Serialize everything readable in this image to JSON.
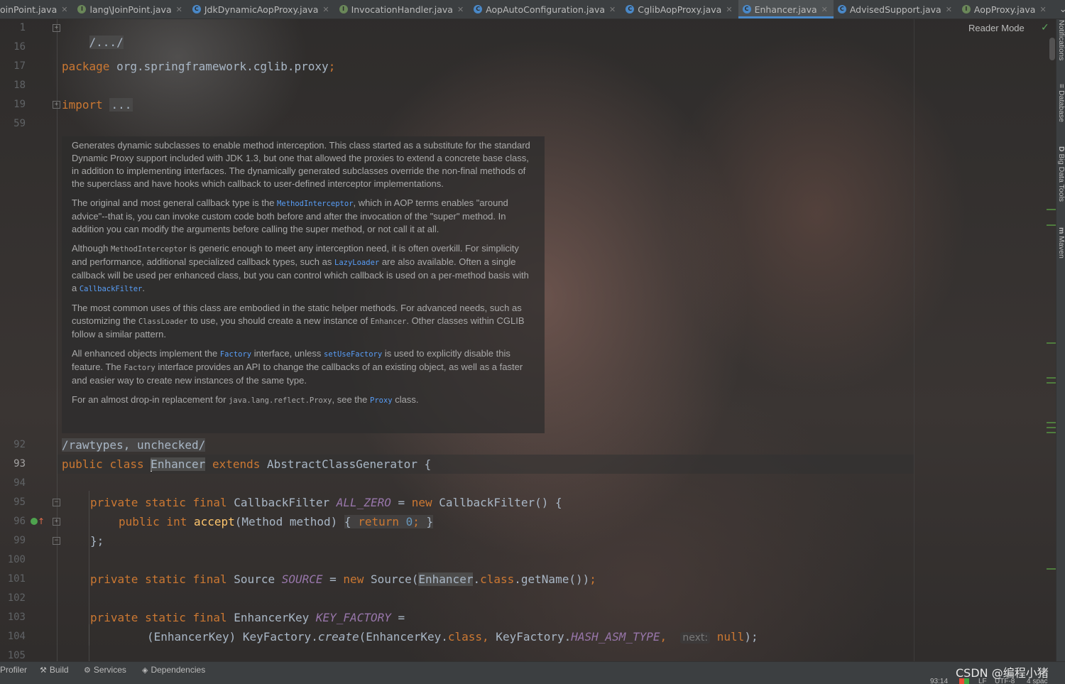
{
  "tabs": [
    {
      "label": "oinPoint.java",
      "icon": "interface-icon",
      "kind": "i"
    },
    {
      "label": "lang\\JoinPoint.java",
      "icon": "interface-icon",
      "kind": "i"
    },
    {
      "label": "JdkDynamicAopProxy.java",
      "icon": "class-icon",
      "kind": "c"
    },
    {
      "label": "InvocationHandler.java",
      "icon": "interface-icon",
      "kind": "i"
    },
    {
      "label": "AopAutoConfiguration.java",
      "icon": "class-icon",
      "kind": "c"
    },
    {
      "label": "CglibAopProxy.java",
      "icon": "class-icon",
      "kind": "c"
    },
    {
      "label": "Enhancer.java",
      "icon": "class-icon",
      "kind": "c",
      "active": true
    },
    {
      "label": "AdvisedSupport.java",
      "icon": "class-icon",
      "kind": "c"
    },
    {
      "label": "AopProxy.java",
      "icon": "interface-icon",
      "kind": "i"
    }
  ],
  "line_numbers": [
    {
      "n": "1"
    },
    {
      "n": "16"
    },
    {
      "n": "17"
    },
    {
      "n": "18"
    },
    {
      "n": "19"
    },
    {
      "n": "59"
    },
    {
      "n": "92"
    },
    {
      "n": "93"
    },
    {
      "n": "94"
    },
    {
      "n": "95"
    },
    {
      "n": "96"
    },
    {
      "n": "99"
    },
    {
      "n": "100"
    },
    {
      "n": "101"
    },
    {
      "n": "102"
    },
    {
      "n": "103"
    },
    {
      "n": "104"
    },
    {
      "n": "105"
    }
  ],
  "code": {
    "l1": "/.../",
    "l17_kw": "package",
    "l17_rest": " org.springframework.cglib.proxy",
    "l17_semi": ";",
    "l19_kw": "import",
    "l19_fold": "...",
    "l92": "/rawtypes, unchecked/",
    "l93_kw1": "public",
    "l93_kw2": "class",
    "l93_name": "Enhancer",
    "l93_kw3": "extends",
    "l93_rest": " AbstractClassGenerator {",
    "l95_kw": "private static final",
    "l95_type": " CallbackFilter ",
    "l95_const": "ALL_ZERO",
    "l95_eq": " = ",
    "l95_new": "new",
    "l95_rest": " CallbackFilter() {",
    "l96_kw": "public int",
    "l96_fn": "accept",
    "l96_args": "(Method method)",
    "l96_ob": "{",
    "l96_ret": "return",
    "l96_num": "0",
    "l96_semi": ";",
    "l96_cb": "}",
    "l99": "};",
    "l101_kw": "private static final",
    "l101_type": " Source ",
    "l101_const": "SOURCE",
    "l101_eq": " = ",
    "l101_new": "new",
    "l101_rest1": " Source(",
    "l101_ref": "Enhancer",
    "l101_dot": ".",
    "l101_class": "class",
    "l101_rest2": ".getName())",
    "l101_semi": ";",
    "l103_kw": "private static final",
    "l103_type": " EnhancerKey ",
    "l103_const": "KEY_FACTORY",
    "l103_eq": " =",
    "l104_a": "(EnhancerKey) KeyFactory.",
    "l104_create": "create",
    "l104_b": "(EnhancerKey.",
    "l104_class": "class",
    "l104_comma": ",",
    "l104_c": " KeyFactory.",
    "l104_const": "HASH_ASM_TYPE",
    "l104_comma2": ",",
    "l104_hint": "next:",
    "l104_null": "null",
    "l104_end": ");"
  },
  "doc": {
    "p1": "Generates dynamic subclasses to enable method interception. This class started as a substitute for the standard Dynamic Proxy support included with JDK 1.3, but one that allowed the proxies to extend a concrete base class, in addition to implementing interfaces. The dynamically generated subclasses override the non-final methods of the superclass and have hooks which callback to user-defined interceptor implementations.",
    "p2a": "The original and most general callback type is the ",
    "p2code": "MethodInterceptor",
    "p2b": ", which in AOP terms enables \"around advice\"--that is, you can invoke custom code both before and after the invocation of the \"super\" method. In addition you can modify the arguments before calling the super method, or not call it at all.",
    "p3a": "Although ",
    "p3code1": "MethodInterceptor",
    "p3b": " is generic enough to meet any interception need, it is often overkill. For simplicity and performance, additional specialized callback types, such as ",
    "p3code2": "LazyLoader",
    "p3c": " are also available. Often a single callback will be used per enhanced class, but you can control which callback is used on a per-method basis with a ",
    "p3code3": "CallbackFilter",
    "p3d": ".",
    "p4a": "The most common uses of this class are embodied in the static helper methods. For advanced needs, such as customizing the ",
    "p4code1": "ClassLoader",
    "p4b": " to use, you should create a new instance of ",
    "p4code2": "Enhancer",
    "p4c": ". Other classes within CGLIB follow a similar pattern.",
    "p5a": "All enhanced objects implement the ",
    "p5code1": "Factory",
    "p5b": " interface, unless ",
    "p5code2": "setUseFactory",
    "p5c": " is used to explicitly disable this feature. The ",
    "p5code3": "Factory",
    "p5d": " interface provides an API to change the callbacks of an existing object, as well as a faster and easier way to create new instances of the same type.",
    "p6a": "For an almost drop-in replacement for ",
    "p6code1": "java.lang.reflect.Proxy",
    "p6b": ", see the ",
    "p6code2": "Proxy",
    "p6c": " class."
  },
  "reader_mode": "Reader Mode",
  "right_tools": [
    {
      "label": "Notifications"
    },
    {
      "label": "Database"
    },
    {
      "label": "Big Data Tools"
    },
    {
      "label": "Maven"
    }
  ],
  "bottom_tools": [
    {
      "label": "Profiler"
    },
    {
      "label": "Build"
    },
    {
      "label": "Services"
    },
    {
      "label": "Dependencies"
    }
  ],
  "status": {
    "time": "93:14",
    "line_sep": "LF",
    "encoding": "UTF-8",
    "indent": "4 spac"
  },
  "watermark": "CSDN @编程小猪",
  "colors": {
    "keyword": "#cc7832",
    "static_field": "#9876aa",
    "method": "#ffc66d",
    "number": "#6897bb",
    "doc_link": "#589df6",
    "accent": "#4a88c7"
  }
}
